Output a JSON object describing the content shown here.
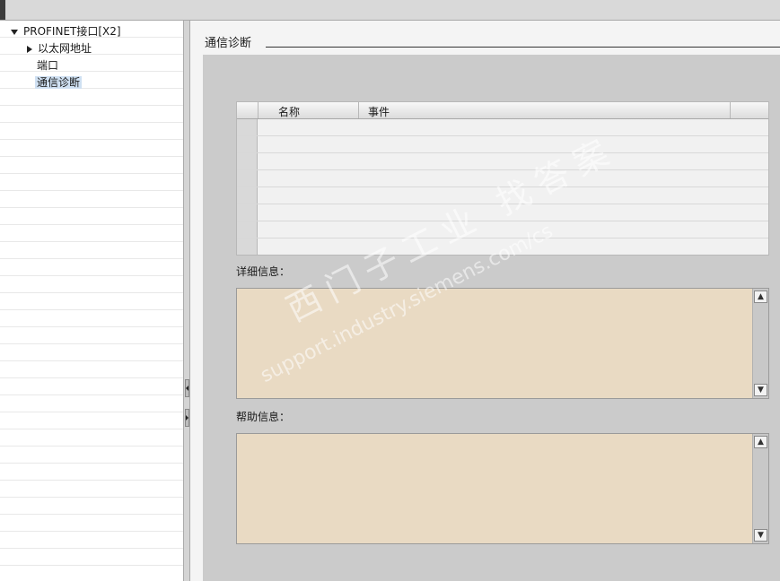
{
  "tree": {
    "items": [
      {
        "label": "PROFINET接口[X2]",
        "expander": "expanded-arrow-icon"
      },
      {
        "label": "以太网地址",
        "expander": "collapsed-arrow-icon"
      },
      {
        "label": "端口"
      },
      {
        "label": "通信诊断",
        "selected": true
      }
    ]
  },
  "section": {
    "title": "通信诊断"
  },
  "table": {
    "columns": [
      "名称",
      "事件"
    ],
    "rows": []
  },
  "details": {
    "label": "详细信息：",
    "value": ""
  },
  "help": {
    "label": "帮助信息：",
    "value": ""
  },
  "watermark": {
    "chinese": "西门子工业 找答案",
    "url": "support.industry.siemens.com/cs"
  },
  "colors": {
    "content_bg": "#cbcbcb",
    "textbox_bg": "#e9dac3",
    "selection": "#cfe0f2"
  }
}
